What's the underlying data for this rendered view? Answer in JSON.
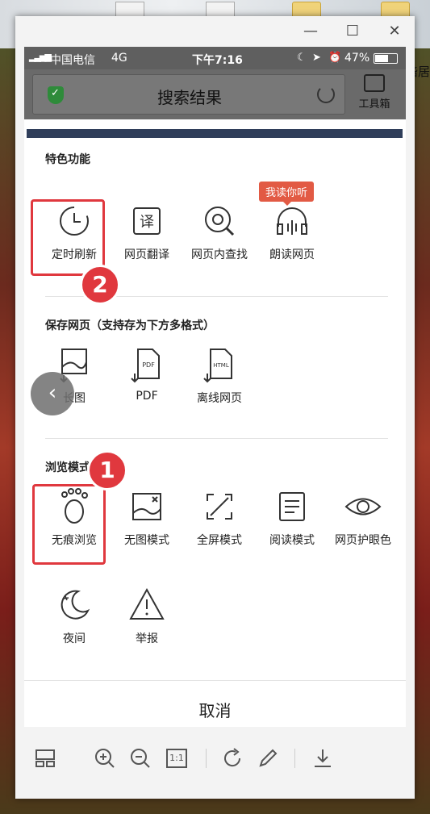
{
  "desktop": {
    "right_label": "啙居"
  },
  "window": {
    "minimize": "—",
    "maximize": "☐",
    "close": "✕"
  },
  "phone_status": {
    "carrier": "中国电信",
    "network": "4G",
    "time": "下午7:16",
    "battery": "47%"
  },
  "browser": {
    "title": "搜索结果",
    "toolbox_label": "工具箱"
  },
  "menu": {
    "featured": {
      "title": "特色功能",
      "tag": "我读你听",
      "items": [
        {
          "label": "定时刷新",
          "icon": "clock-refresh-icon"
        },
        {
          "label": "网页翻译",
          "icon": "translate-icon"
        },
        {
          "label": "网页内查找",
          "icon": "find-in-page-icon"
        },
        {
          "label": "朗读网页",
          "icon": "headphones-icon"
        }
      ]
    },
    "save": {
      "title": "保存网页（支持存为下方多格式）",
      "items": [
        {
          "label": "长图",
          "icon": "long-image-icon"
        },
        {
          "label": "PDF",
          "icon": "pdf-file-icon"
        },
        {
          "label": "离线网页",
          "icon": "html-file-icon"
        }
      ]
    },
    "browse": {
      "title": "浏览模式",
      "items": [
        {
          "label": "无痕浏览",
          "icon": "footprint-icon"
        },
        {
          "label": "无图模式",
          "icon": "no-image-icon"
        },
        {
          "label": "全屏模式",
          "icon": "fullscreen-icon"
        },
        {
          "label": "阅读模式",
          "icon": "reading-icon"
        },
        {
          "label": "网页护眼色",
          "icon": "eye-icon"
        },
        {
          "label": "夜间",
          "icon": "night-moon-icon"
        },
        {
          "label": "举报",
          "icon": "warning-icon"
        }
      ]
    },
    "cancel": "取消"
  },
  "annotations": {
    "badge1": "1",
    "badge2": "2"
  },
  "viewer_toolbar": {
    "zoom_actual": "1:1"
  },
  "colors": {
    "highlight": "#e0383e",
    "tag": "#e25a44",
    "shield": "#2e8b3a"
  }
}
